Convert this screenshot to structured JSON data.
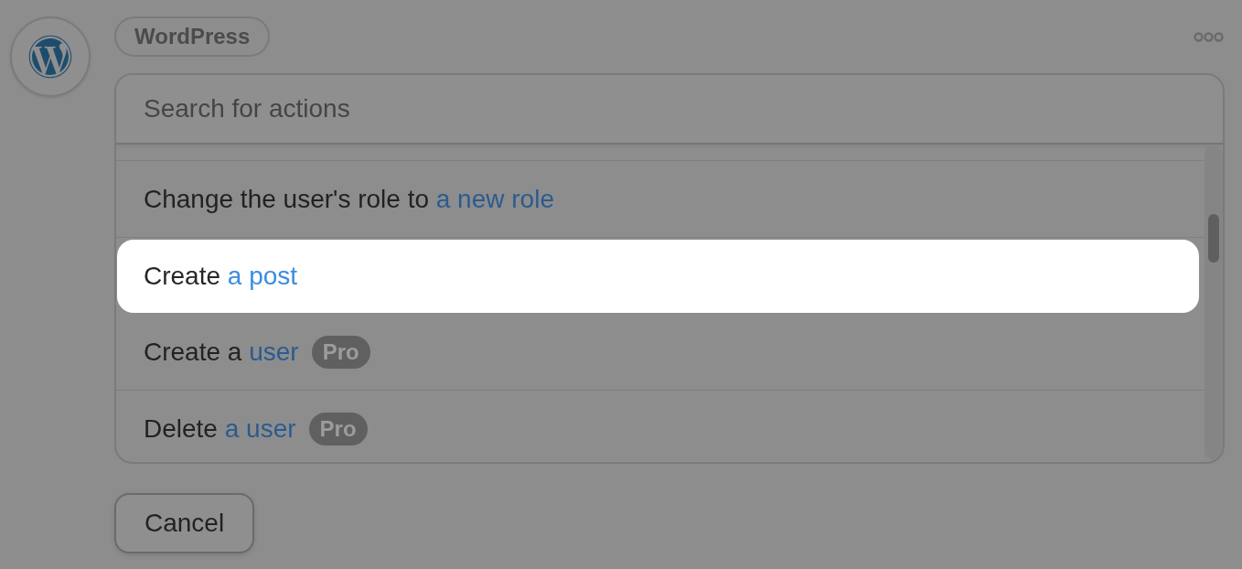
{
  "app": {
    "name": "WordPress"
  },
  "search": {
    "placeholder": "Search for actions"
  },
  "actions": [
    {
      "verb": "Change the user's role to",
      "object": "a new role",
      "selected": false
    },
    {
      "verb": "Create",
      "object": "a post",
      "selected": true
    },
    {
      "verb": "Create a",
      "object": "user",
      "badge": "Pro",
      "selected": false
    },
    {
      "verb": "Delete",
      "object": "a user",
      "badge": "Pro",
      "selected": false
    }
  ],
  "buttons": [
    {
      "label": "Cancel"
    }
  ]
}
